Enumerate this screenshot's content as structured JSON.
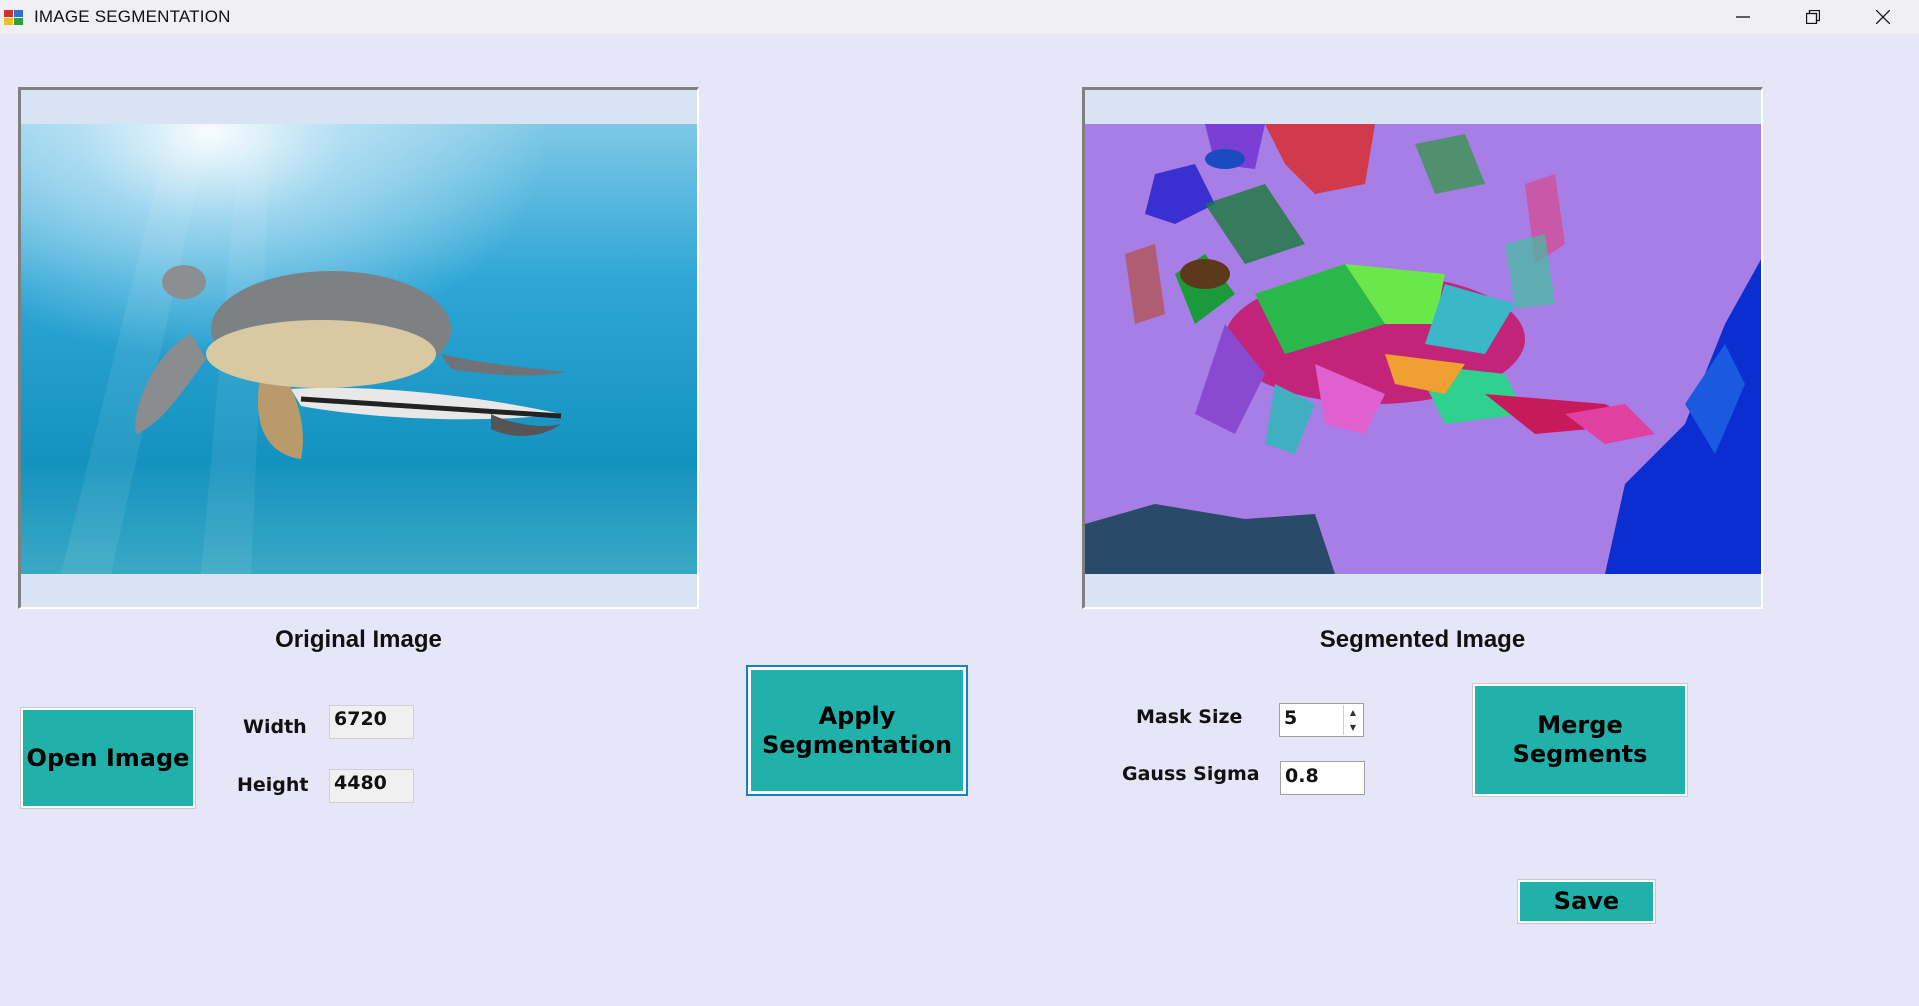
{
  "window": {
    "title": "IMAGE SEGMENTATION"
  },
  "original": {
    "caption": "Original Image",
    "image_alt": "Sea turtle swimming underwater"
  },
  "segmented": {
    "caption": "Segmented Image",
    "image_alt": "Segmented sea turtle image"
  },
  "buttons": {
    "open_image": "Open Image",
    "apply_segmentation": "Apply Segmentation",
    "merge_segments": "Merge Segments",
    "save": "Save"
  },
  "dimensions": {
    "width_label": "Width",
    "width_value": "6720",
    "height_label": "Height",
    "height_value": "4480"
  },
  "params": {
    "mask_size_label": "Mask Size",
    "mask_size_value": "5",
    "gauss_sigma_label": "Gauss Sigma",
    "gauss_sigma_value": "0.8"
  },
  "colors": {
    "background": "#e6e6f8",
    "button": "#20b2aa",
    "segment_bg": "#a77ee6"
  }
}
